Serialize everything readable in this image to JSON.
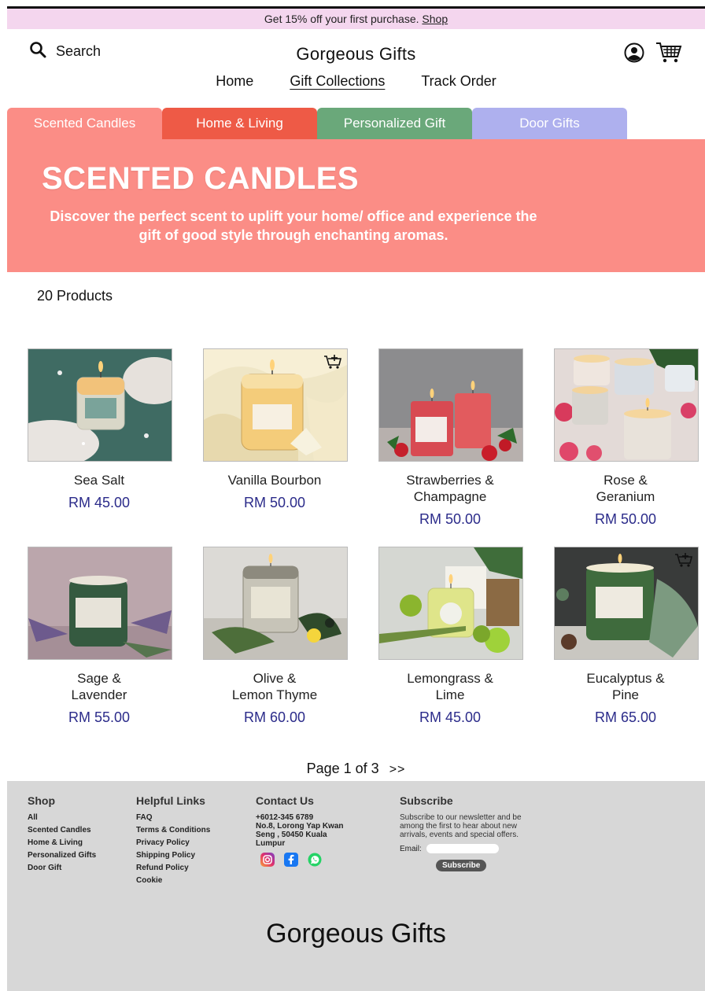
{
  "promo": {
    "text": "Get 15% off your first purchase.",
    "link": "Shop"
  },
  "header": {
    "search_label": "Search",
    "brand": "Gorgeous Gifts"
  },
  "nav": {
    "home": "Home",
    "collections": "Gift Collections",
    "track": "Track Order"
  },
  "tabs": [
    {
      "label": "Scented Candles",
      "color": "#fb8d86"
    },
    {
      "label": "Home & Living",
      "color": "#ee5a46"
    },
    {
      "label": "Personalized Gift",
      "color": "#6aa87a"
    },
    {
      "label": "Door Gifts",
      "color": "#aeb0ee"
    }
  ],
  "hero": {
    "title": "SCENTED CANDLES",
    "subtitle": "Discover the perfect scent to uplift your home/ office and experience the gift of good style through enchanting aromas."
  },
  "product_count": "20 Products",
  "products": [
    {
      "name_line1": "Sea Salt",
      "name_line2": "",
      "price": "RM 45.00"
    },
    {
      "name_line1": "Vanilla Bourbon",
      "name_line2": "",
      "price": "RM 50.00"
    },
    {
      "name_line1": "Strawberries &",
      "name_line2": "Champagne",
      "price": "RM 50.00"
    },
    {
      "name_line1": "Rose &",
      "name_line2": "Geranium",
      "price": "RM 50.00"
    },
    {
      "name_line1": "Sage &",
      "name_line2": "Lavender",
      "price": "RM 55.00"
    },
    {
      "name_line1": "Olive &",
      "name_line2": "Lemon Thyme",
      "price": "RM 60.00"
    },
    {
      "name_line1": "Lemongrass &",
      "name_line2": "Lime",
      "price": "RM 45.00"
    },
    {
      "name_line1": "Eucalyptus &",
      "name_line2": "Pine",
      "price": "RM 65.00"
    }
  ],
  "pager": {
    "text": "Page 1 of 3",
    "next": ">>"
  },
  "footer": {
    "shop": {
      "heading": "Shop",
      "links": [
        "All",
        "Scented Candles",
        "Home & Living",
        "Personalized Gifts",
        "Door Gift"
      ]
    },
    "help": {
      "heading": "Helpful Links",
      "links": [
        "FAQ",
        "Terms & Conditions",
        "Privacy Policy",
        "Shipping Policy",
        "Refund Policy",
        "Cookie"
      ]
    },
    "contact": {
      "heading": "Contact Us",
      "phone": "+6012-345 6789",
      "address1": "No.8, Lorong Yap Kwan",
      "address2": "Seng , 50450 Kuala",
      "address3": "Lumpur"
    },
    "subscribe": {
      "heading": "Subscribe",
      "text": "Subscribe to our newsletter and be among the first to hear about new arrivals, events and special offers.",
      "email_label": "Email:",
      "button": "Subscribe"
    },
    "brand": "Gorgeous Gifts"
  }
}
